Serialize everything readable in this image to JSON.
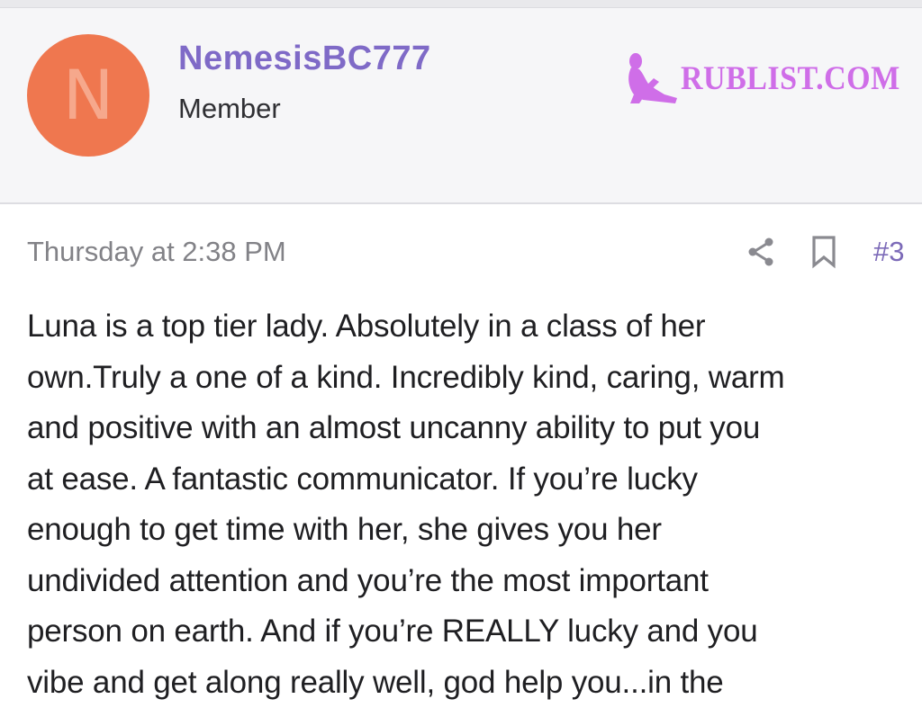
{
  "user": {
    "avatar_letter": "N",
    "avatar_color": "#ef774f",
    "name": "NemesisBC777",
    "title": "Member"
  },
  "watermark": {
    "text": "RUBLIST.COM",
    "color": "#cf6ee8"
  },
  "post": {
    "timestamp": "Thursday at 2:38 PM",
    "share_icon": "share-icon",
    "bookmark_icon": "bookmark-icon",
    "number": "#3",
    "body_lines": [
      "Luna is a top tier lady. Absolutely in a class of her",
      "own.Truly a one of a kind. Incredibly kind, caring, warm",
      "and positive with an almost uncanny ability to put you",
      "at ease. A fantastic communicator. If you’re lucky",
      "enough to get time with her, she gives you her",
      "undivided attention and you’re the most important",
      "person on earth. And if you’re REALLY lucky and you",
      "vibe and get along really well, god help you...in the"
    ]
  },
  "colors": {
    "accent": "#7f6ac7",
    "header_bg": "#f6f6f8",
    "muted_text": "#828287"
  }
}
